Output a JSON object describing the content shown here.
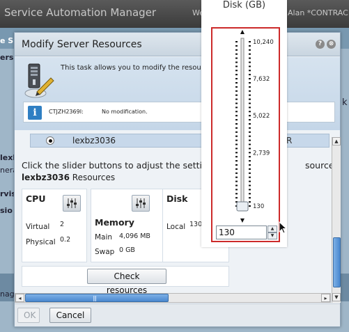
{
  "app": {
    "title": "Service Automation Manager",
    "header_fragment": "We",
    "user": "Alan *CONTRAC",
    "left_fragments": [
      "e S",
      "ers",
      "lexb",
      "nera",
      "rvis",
      "sio",
      "nag"
    ],
    "right_fragments": [
      "k"
    ]
  },
  "dialog": {
    "title": "Modify Server Resources",
    "help_icon": "?",
    "close_icon": "⊗",
    "intro_text": "This task allows you to modify the resources",
    "message": {
      "code": "CTJZH2369I:",
      "text": "No modification."
    },
    "server": {
      "name": "lexbz3036",
      "trailing": "R"
    },
    "instructions": "Click the slider buttons to adjust the settings",
    "instructions_tail": "sources.",
    "resources_server": "lexbz3036",
    "resources_label": "Resources",
    "cpu": {
      "title": "CPU",
      "virtual_label": "Virtual",
      "virtual_value": "2",
      "physical_label": "Physical",
      "physical_value": "0.2"
    },
    "memory": {
      "title": "Memory",
      "main_label": "Main",
      "main_value": "4,096 MB",
      "swap_label": "Swap",
      "swap_value": "0 GB"
    },
    "disk": {
      "title": "Disk",
      "local_label": "Local",
      "local_value": "130"
    },
    "check_button": "Check resources",
    "ok_button": "OK",
    "cancel_button": "Cancel",
    "hscroll_left": "◂",
    "hscroll_right": "▸",
    "hscroll_grip": "|||"
  },
  "slider_popup": {
    "title": "Disk (GB)",
    "tick_labels": [
      "10,240",
      "7,632",
      "5,022",
      "2,739",
      "130"
    ],
    "value": "130",
    "slider_position": 0
  },
  "colors": {
    "header_bg": "#4a4a4a",
    "highlight_frame": "#cc2a2a",
    "selection_row": "#c7d8ea",
    "scroll_thumb": "#4a88cf"
  }
}
